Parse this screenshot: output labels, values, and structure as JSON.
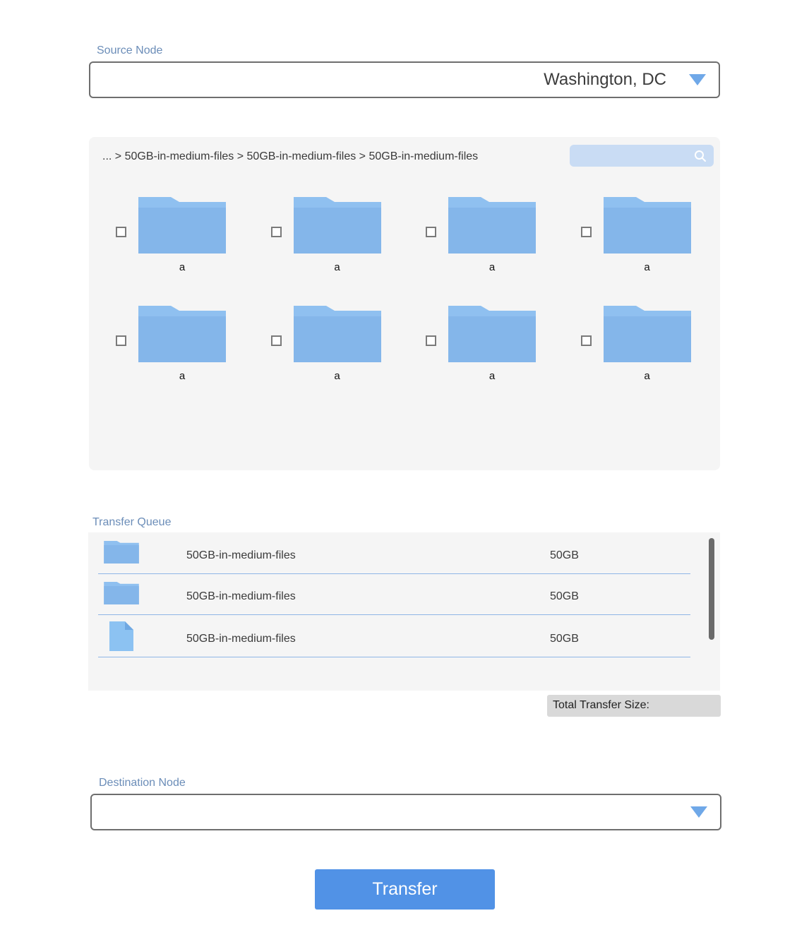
{
  "source": {
    "label": "Source Node",
    "value": "Washington, DC"
  },
  "browser": {
    "breadcrumb": "... > 50GB-in-medium-files > 50GB-in-medium-files > 50GB-in-medium-files",
    "search_placeholder": "",
    "items": [
      {
        "name": "a",
        "checked": false
      },
      {
        "name": "a",
        "checked": false
      },
      {
        "name": "a",
        "checked": false
      },
      {
        "name": "a",
        "checked": false
      },
      {
        "name": "a",
        "checked": false
      },
      {
        "name": "a",
        "checked": false
      },
      {
        "name": "a",
        "checked": false
      },
      {
        "name": "a",
        "checked": false
      }
    ]
  },
  "queue": {
    "label": "Transfer Queue",
    "rows": [
      {
        "type": "folder-icon",
        "name": "50GB-in-medium-files",
        "size": "50GB"
      },
      {
        "type": "folder-icon",
        "name": "50GB-in-medium-files",
        "size": "50GB"
      },
      {
        "type": "file-icon",
        "name": "50GB-in-medium-files",
        "size": "50GB"
      }
    ],
    "total_label": "Total Transfer Size:"
  },
  "destination": {
    "label": "Destination Node",
    "value": ""
  },
  "transfer_button": "Transfer",
  "colors": {
    "accent": "#5192e6",
    "folder": "#84b6ea",
    "folder_tab": "#8fc0f0",
    "panel": "#f5f5f5",
    "label": "#6b8db8"
  }
}
